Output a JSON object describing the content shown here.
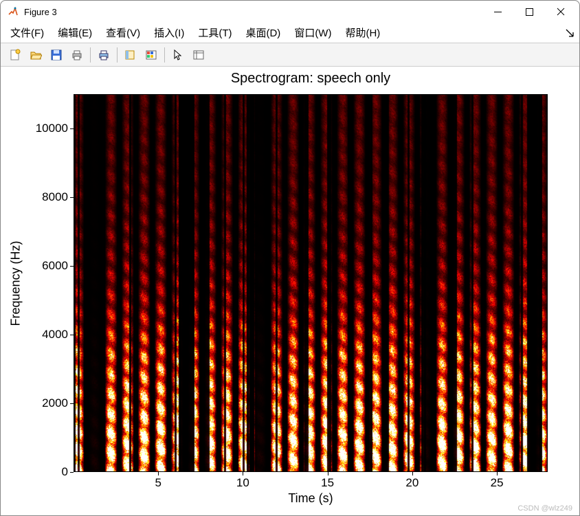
{
  "window": {
    "title": "Figure 3"
  },
  "menu": {
    "items": [
      "文件(F)",
      "编辑(E)",
      "查看(V)",
      "插入(I)",
      "工具(T)",
      "桌面(D)",
      "窗口(W)",
      "帮助(H)"
    ]
  },
  "toolbar": {
    "icons": [
      "new-figure-icon",
      "open-icon",
      "save-icon",
      "print-icon",
      "SEP",
      "print-preview-icon",
      "SEP",
      "link-axes-icon",
      "colorbar-icon",
      "SEP",
      "pointer-icon",
      "data-cursor-icon"
    ]
  },
  "chart_data": {
    "type": "heatmap",
    "title": "Spectrogram: speech only",
    "xlabel": "Time (s)",
    "ylabel": "Frequency (Hz)",
    "xlim": [
      0,
      28
    ],
    "ylim": [
      0,
      11000
    ],
    "xticks": [
      5,
      10,
      15,
      20,
      25
    ],
    "yticks": [
      0,
      2000,
      4000,
      6000,
      8000,
      10000
    ],
    "colormap": "hot",
    "description": "Speech spectrogram; vertical striations (harmonics/formants) concentrated 0–4000 Hz bright yellow-orange, fading to darker red 6000–11000 Hz, with black gaps between speech segments."
  },
  "watermark": "CSDN @wlz249"
}
